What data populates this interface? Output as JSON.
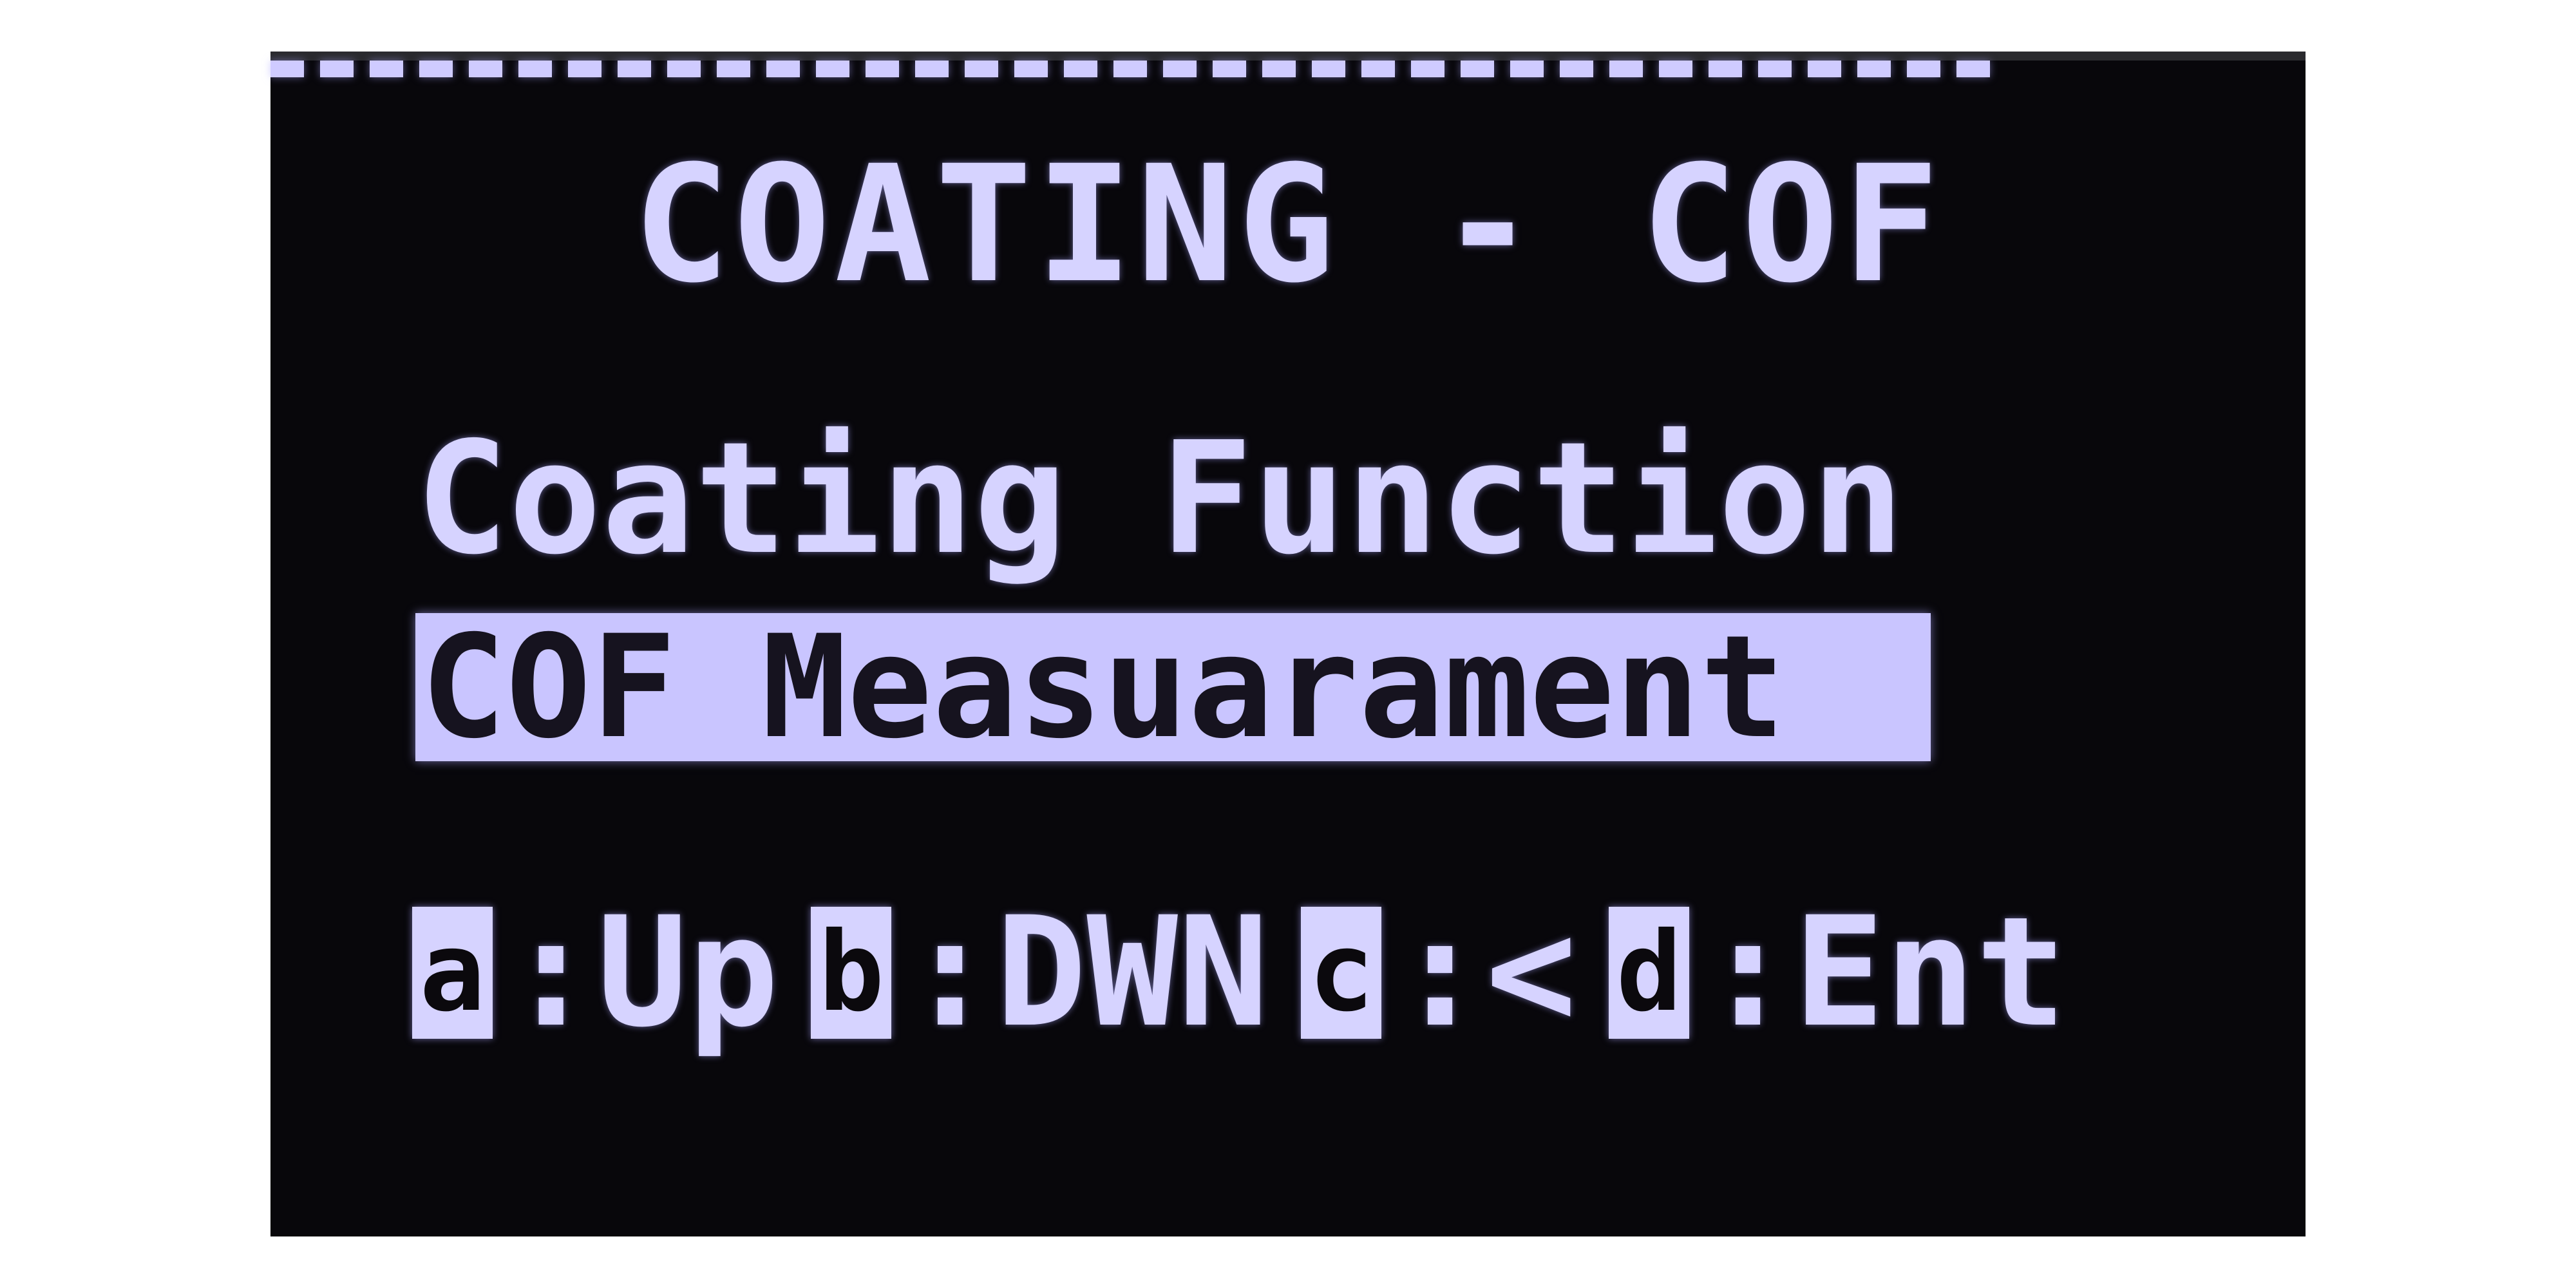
{
  "screen": {
    "title": "COATING - COF",
    "menu": [
      {
        "label": "Coating Function",
        "selected": false
      },
      {
        "label": "COF Measuarament",
        "selected": true
      }
    ],
    "keys": [
      {
        "key": "a",
        "label": ":Up"
      },
      {
        "key": "b",
        "label": ":DWN"
      },
      {
        "key": "c",
        "label": ":<"
      },
      {
        "key": "d",
        "label": ":Ent"
      }
    ]
  },
  "colors": {
    "background": "#08070b",
    "text": "#d6d3ff",
    "highlight": "#c9c5ff"
  }
}
